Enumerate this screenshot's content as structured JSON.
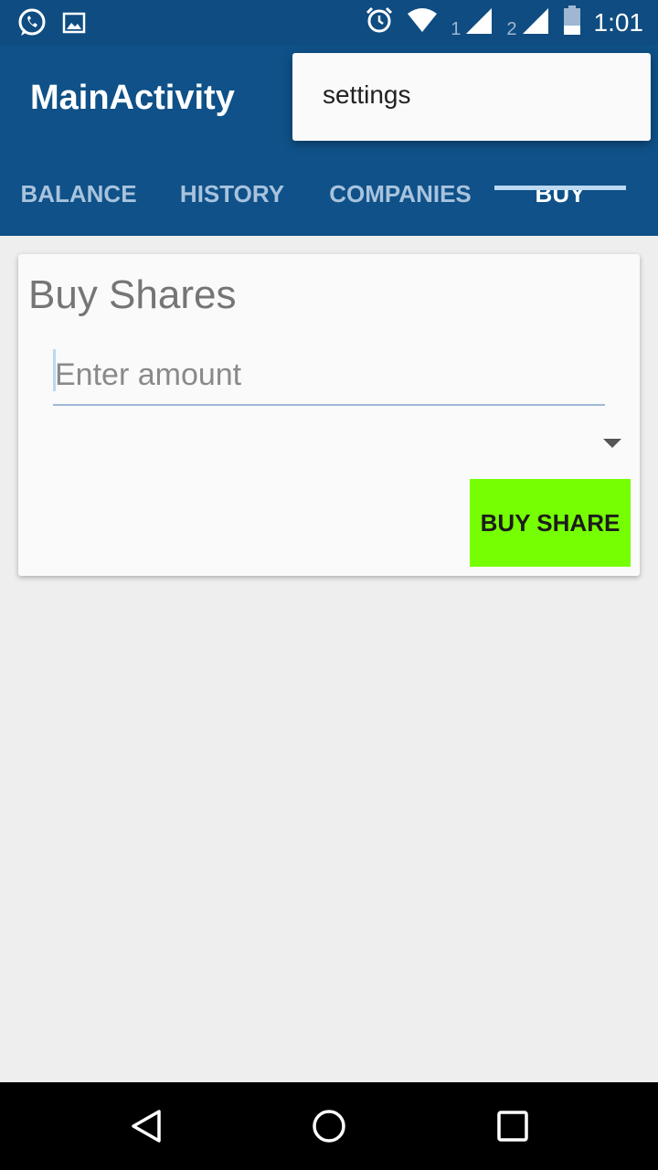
{
  "status_bar": {
    "time": "1:01",
    "sim1_label": "1",
    "sim2_label": "2",
    "icons": [
      "whatsapp-icon",
      "image-icon",
      "alarm-icon",
      "wifi-icon",
      "signal-icon",
      "signal-icon",
      "battery-icon"
    ]
  },
  "app_bar": {
    "title": "MainActivity"
  },
  "tabs": [
    {
      "label": "BALANCE"
    },
    {
      "label": "HISTORY"
    },
    {
      "label": "COMPANIES"
    },
    {
      "label": "BUY"
    }
  ],
  "active_tab": "BUY",
  "popup_menu": {
    "items": [
      {
        "label": "settings"
      }
    ]
  },
  "card": {
    "title": "Buy Shares",
    "amount_input": {
      "placeholder": "Enter amount",
      "value": ""
    },
    "spinner": {
      "selected": ""
    },
    "buy_button_label": "BUY SHARE"
  },
  "nav_bar": {
    "icons": [
      "back-icon",
      "home-icon",
      "recents-icon"
    ]
  },
  "colors": {
    "primary": "#0F5188",
    "status_bar": "#0F4C81",
    "buy_button": "#76FF03",
    "background": "#EEEEEE"
  }
}
